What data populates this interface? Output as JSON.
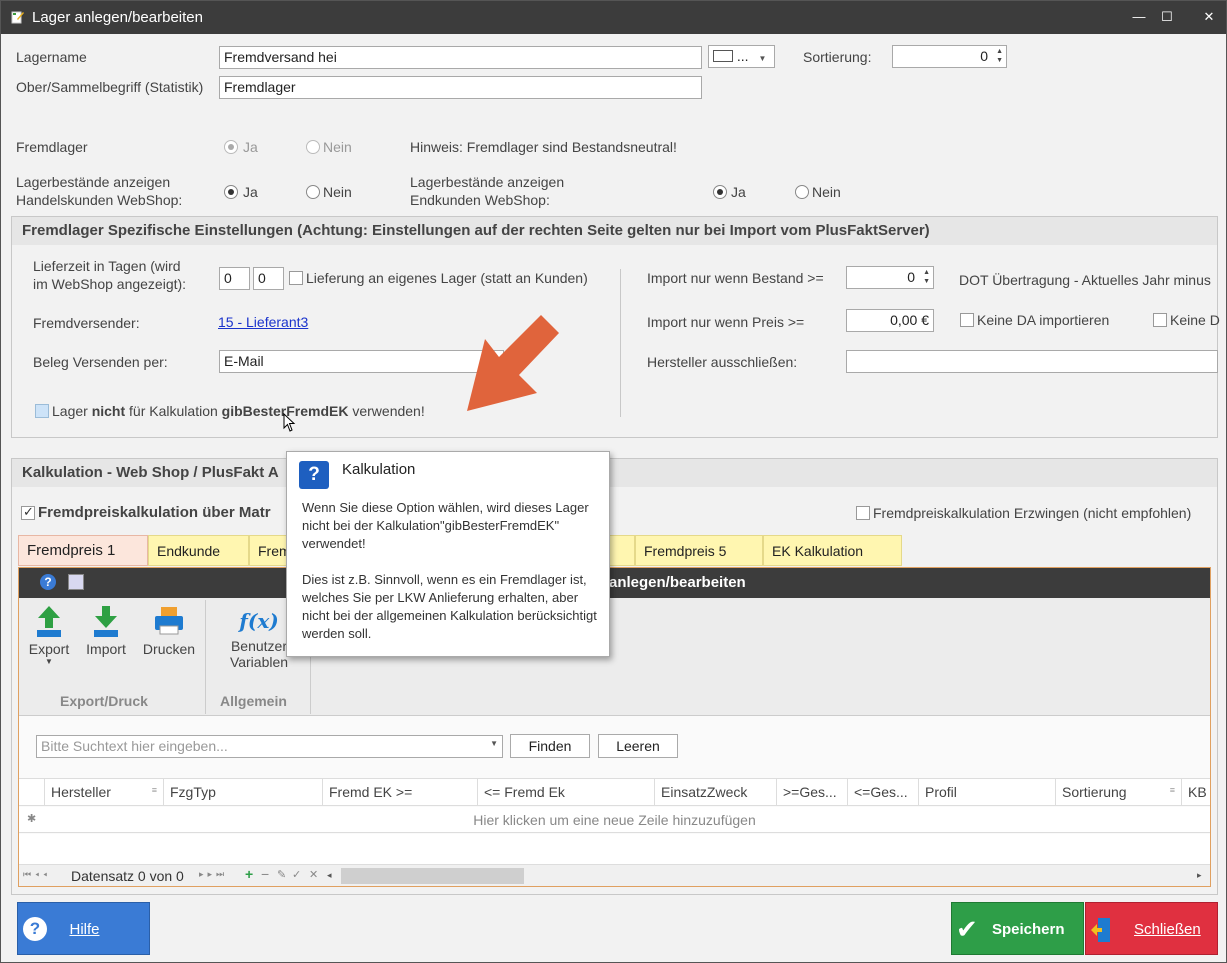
{
  "window": {
    "title": "Lager anlegen/bearbeiten",
    "minimize": "—",
    "maximize": "☐",
    "close": "✕"
  },
  "form": {
    "lagername_label": "Lagername",
    "lagername_value": "Fremdversand hei",
    "color_dropdown": "...",
    "sortierung_label": "Sortierung:",
    "sortierung_value": "0",
    "ober_label": "Ober/Sammelbegriff (Statistik)",
    "ober_value": "Fremdlager",
    "fremdlager_label": "Fremdlager",
    "ja": "Ja",
    "nein": "Nein",
    "hinweis": "Hinweis: Fremdlager sind Bestandsneutral!",
    "lb_handel_label_1": "Lagerbestände anzeigen",
    "lb_handel_label_2": "Handelskunden WebShop:",
    "lb_end_label_1": "Lagerbestände anzeigen",
    "lb_end_label_2": "Endkunden WebShop:"
  },
  "fremd_group": {
    "header": "Fremdlager Spezifische Einstellungen (Achtung: Einstellungen auf der rechten Seite gelten nur bei Import vom PlusFaktServer)",
    "lieferzeit_label_1": "Lieferzeit in Tagen (wird",
    "lieferzeit_label_2": "im WebShop angezeigt):",
    "lieferzeit_1": "0",
    "lieferzeit_2": "0",
    "lieferung_eigen": "Lieferung an eigenes Lager (statt an Kunden)",
    "fremdversender_label": "Fremdversender:",
    "fremdversender_link": "15 - Lieferant3",
    "beleg_label": "Beleg Versenden per:",
    "beleg_value": "E-Mail",
    "lager_nicht_pre": "Lager ",
    "lager_nicht_bold1": "nicht",
    "lager_nicht_mid": " für Kalkulation ",
    "lager_nicht_bold2": "gibBesterFremdEK",
    "lager_nicht_post": " verwenden!",
    "import_bestand_label": "Import nur wenn Bestand >=",
    "import_bestand_value": "0",
    "dot_label": "DOT Übertragung - Aktuelles Jahr minus",
    "import_preis_label": "Import nur wenn Preis >=",
    "import_preis_value": "0,00 €",
    "keine_da": "Keine DA importieren",
    "keine_d": "Keine D",
    "hersteller_label": "Hersteller ausschließen:"
  },
  "kalk_group": {
    "header": "Kalkulation - Web Shop / PlusFakt A",
    "fremdpreis_matrix": "Fremdpreiskalkulation über Matr",
    "erzwingen": "Fremdpreiskalkulation Erzwingen (nicht empfohlen)",
    "tabs": [
      "Fremdpreis 1",
      "Endkunde",
      "Frem",
      "Fremdpreis 5",
      "EK Kalkulation"
    ],
    "inner_title": "anlegen/bearbeiten",
    "ribbon": {
      "export": "Export",
      "import": "Import",
      "drucken": "Drucken",
      "benutzer_1": "Benutzer",
      "benutzer_2": "Variablen",
      "group_export": "Export/Druck",
      "group_allgemein": "Allgemein"
    },
    "search_placeholder": "Bitte Suchtext hier eingeben...",
    "finden": "Finden",
    "leeren": "Leeren",
    "columns": [
      "Hersteller",
      "FzgTyp",
      "Fremd EK >=",
      "<= Fremd Ek",
      "EinsatzZweck",
      ">=Ges...",
      "<=Ges...",
      "Profil",
      "Sortierung",
      "KB"
    ],
    "new_row": "Hier klicken um eine neue Zeile hinzuzufügen",
    "nav_text": "Datensatz 0 von 0"
  },
  "buttons": {
    "hilfe": "Hilfe",
    "speichern": "Speichern",
    "schliessen": "Schließen"
  },
  "tooltip": {
    "title": "Kalkulation",
    "body": "Wenn Sie diese Option wählen, wird dieses Lager nicht bei der Kalkulation\"gibBesterFremdEK\" verwendet!\n\nDies ist z.B. Sinnvoll, wenn es ein Fremdlager ist, welches Sie per LKW Anlieferung erhalten, aber nicht bei der allgemeinen Kalkulation berücksichtigt werden soll."
  },
  "colors": {
    "titlebar": "#3c3c3c",
    "arrow": "#e0643c",
    "hilfe": "#3a7bd5",
    "speichern": "#2e9e48",
    "schliessen": "#e03040",
    "tab_yellow": "#fff6b0",
    "tab_active": "#fce6dc"
  }
}
